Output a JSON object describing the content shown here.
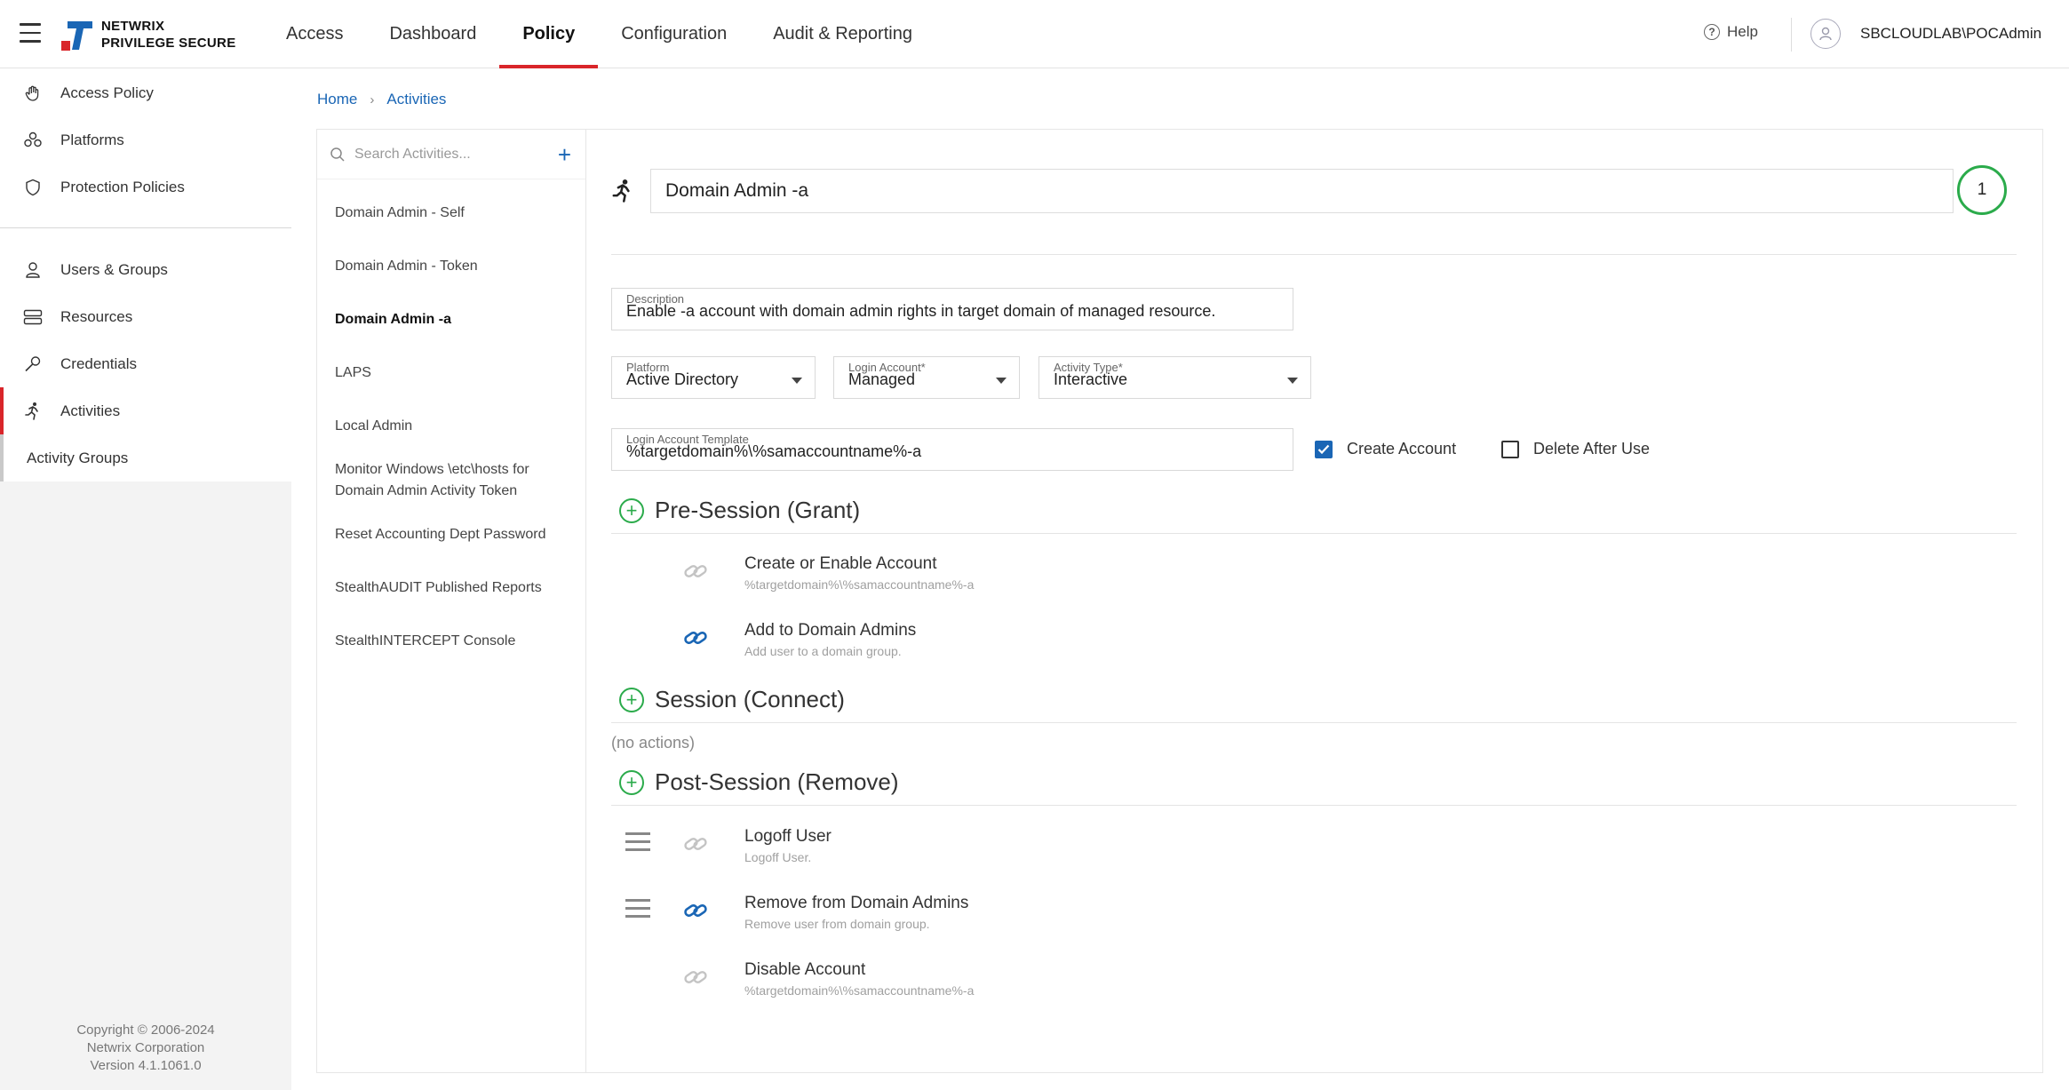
{
  "app": {
    "brand_line1": "NETWRIX",
    "brand_line2": "PRIVILEGE SECURE",
    "accent_color": "#d9252a",
    "brand_blue": "#1a66b5"
  },
  "topnav": {
    "tabs": [
      {
        "label": "Access"
      },
      {
        "label": "Dashboard"
      },
      {
        "label": "Policy",
        "active": true
      },
      {
        "label": "Configuration"
      },
      {
        "label": "Audit & Reporting"
      }
    ],
    "help_label": "Help",
    "username": "SBCLOUDLAB\\POCAdmin"
  },
  "sidebar": {
    "items": [
      {
        "label": "Access Policy",
        "icon": "hand-icon"
      },
      {
        "label": "Platforms",
        "icon": "platforms-icon"
      },
      {
        "label": "Protection Policies",
        "icon": "shield-icon"
      },
      {
        "label": "Users & Groups",
        "icon": "user-icon"
      },
      {
        "label": "Resources",
        "icon": "server-icon"
      },
      {
        "label": "Credentials",
        "icon": "key-icon"
      },
      {
        "label": "Activities",
        "icon": "runner-icon",
        "active": true
      }
    ],
    "sub_item": "Activity Groups",
    "footer_line1": "Copyright © 2006-2024",
    "footer_line2": "Netwrix Corporation",
    "footer_line3": "Version 4.1.1061.0"
  },
  "breadcrumb": {
    "home": "Home",
    "current": "Activities"
  },
  "activities": {
    "search_placeholder": "Search Activities...",
    "add_symbol": "+",
    "items": [
      "Domain Admin - Self",
      "Domain Admin - Token",
      "Domain Admin -a",
      "LAPS",
      "Local Admin",
      "Monitor Windows \\etc\\hosts for Domain Admin Activity Token",
      "Reset Accounting Dept Password",
      "StealthAUDIT Published Reports",
      "StealthINTERCEPT Console"
    ],
    "selected_index": 2
  },
  "detail": {
    "name": "Domain Admin -a",
    "badge_count": "1",
    "description_label": "Description",
    "description_value": "Enable -a account with domain admin rights in target domain of managed resource.",
    "platform_label": "Platform",
    "platform_value": "Active Directory",
    "login_account_label": "Login Account*",
    "login_account_value": "Managed",
    "activity_type_label": "Activity Type*",
    "activity_type_value": "Interactive",
    "template_label": "Login Account Template",
    "template_value": "%targetdomain%\\%samaccountname%-a",
    "create_account_label": "Create Account",
    "create_account_checked": true,
    "delete_after_use_label": "Delete After Use",
    "delete_after_use_checked": false
  },
  "sections": {
    "pre": {
      "title": "Pre-Session (Grant)",
      "actions": [
        {
          "title": "Create or Enable Account",
          "subtitle": "%targetdomain%\\%samaccountname%-a",
          "linked": false
        },
        {
          "title": "Add to Domain Admins",
          "subtitle": "Add user to a domain group.",
          "linked": true
        }
      ]
    },
    "session": {
      "title": "Session (Connect)",
      "empty_text": "(no actions)"
    },
    "post": {
      "title": "Post-Session (Remove)",
      "actions": [
        {
          "title": "Logoff User",
          "subtitle": "Logoff User.",
          "linked": false
        },
        {
          "title": "Remove from Domain Admins",
          "subtitle": "Remove user from domain group.",
          "linked": true
        },
        {
          "title": "Disable Account",
          "subtitle": "%targetdomain%\\%samaccountname%-a",
          "linked": false
        }
      ]
    }
  }
}
